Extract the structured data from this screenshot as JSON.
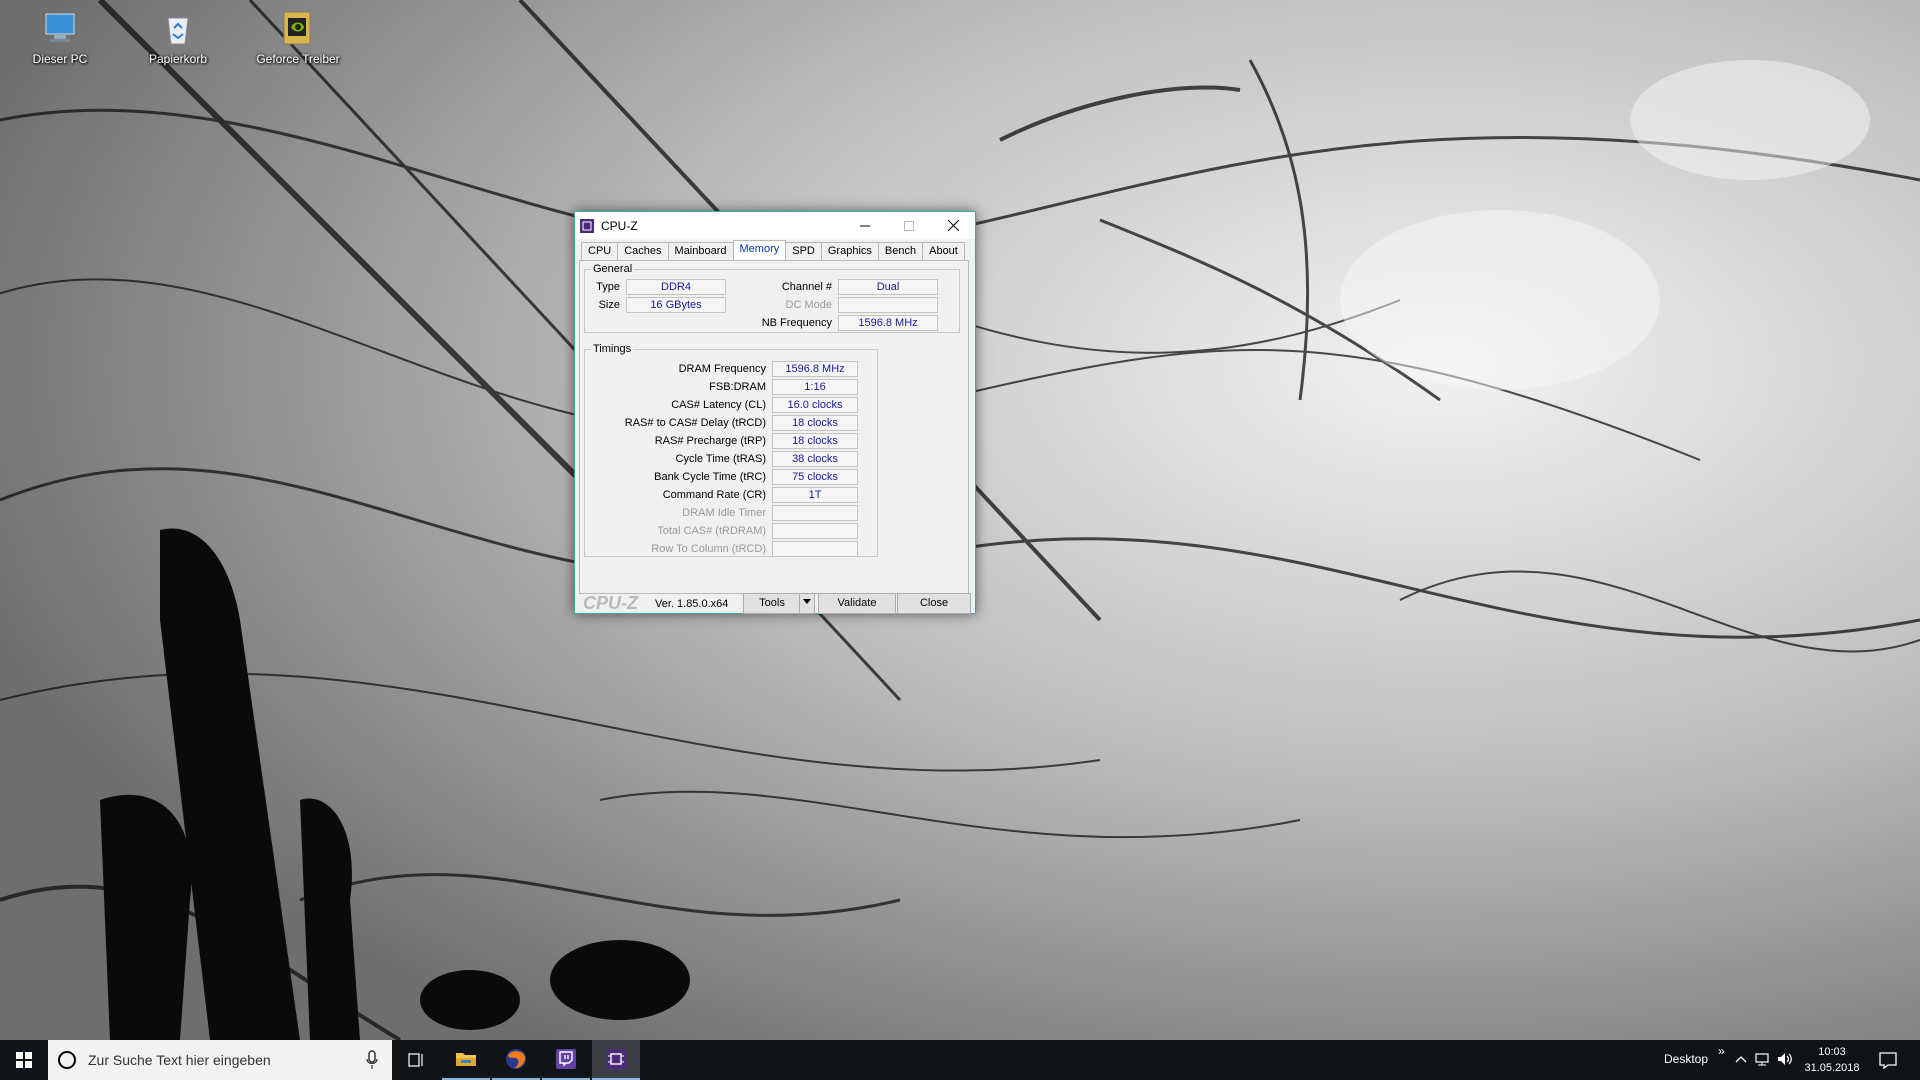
{
  "desktop": {
    "icons": [
      {
        "label": "Dieser PC"
      },
      {
        "label": "Papierkorb"
      },
      {
        "label": "Geforce Treiber"
      }
    ]
  },
  "window": {
    "title": "CPU-Z",
    "tabs": [
      "CPU",
      "Caches",
      "Mainboard",
      "Memory",
      "SPD",
      "Graphics",
      "Bench",
      "About"
    ],
    "active_tab": "Memory",
    "general": {
      "legend": "General",
      "type_label": "Type",
      "type_value": "DDR4",
      "size_label": "Size",
      "size_value": "16 GBytes",
      "channel_label": "Channel #",
      "channel_value": "Dual",
      "dcmode_label": "DC Mode",
      "dcmode_value": "",
      "nbfreq_label": "NB Frequency",
      "nbfreq_value": "1596.8 MHz"
    },
    "timings": {
      "legend": "Timings",
      "rows": [
        {
          "label": "DRAM Frequency",
          "value": "1596.8 MHz",
          "enabled": true
        },
        {
          "label": "FSB:DRAM",
          "value": "1:16",
          "enabled": true
        },
        {
          "label": "CAS# Latency (CL)",
          "value": "16.0 clocks",
          "enabled": true
        },
        {
          "label": "RAS# to CAS# Delay (tRCD)",
          "value": "18 clocks",
          "enabled": true
        },
        {
          "label": "RAS# Precharge (tRP)",
          "value": "18 clocks",
          "enabled": true
        },
        {
          "label": "Cycle Time (tRAS)",
          "value": "38 clocks",
          "enabled": true
        },
        {
          "label": "Bank Cycle Time (tRC)",
          "value": "75 clocks",
          "enabled": true
        },
        {
          "label": "Command Rate (CR)",
          "value": "1T",
          "enabled": true
        },
        {
          "label": "DRAM Idle Timer",
          "value": "",
          "enabled": false
        },
        {
          "label": "Total CAS# (tRDRAM)",
          "value": "",
          "enabled": false
        },
        {
          "label": "Row To Column (tRCD)",
          "value": "",
          "enabled": false
        }
      ]
    },
    "footer": {
      "logo": "CPU-Z",
      "version": "Ver. 1.85.0.x64",
      "tools_label": "Tools",
      "validate_label": "Validate",
      "close_label": "Close"
    }
  },
  "taskbar": {
    "search_placeholder": "Zur Suche Text hier eingeben",
    "desktop_label": "Desktop",
    "chevron": "»",
    "time": "10:03",
    "date": "31.05.2018"
  },
  "colors": {
    "window_border": "#3aa7b5",
    "value_text": "#1a1a9a",
    "active_tab": "#0033cc",
    "taskbar": "#101418"
  }
}
